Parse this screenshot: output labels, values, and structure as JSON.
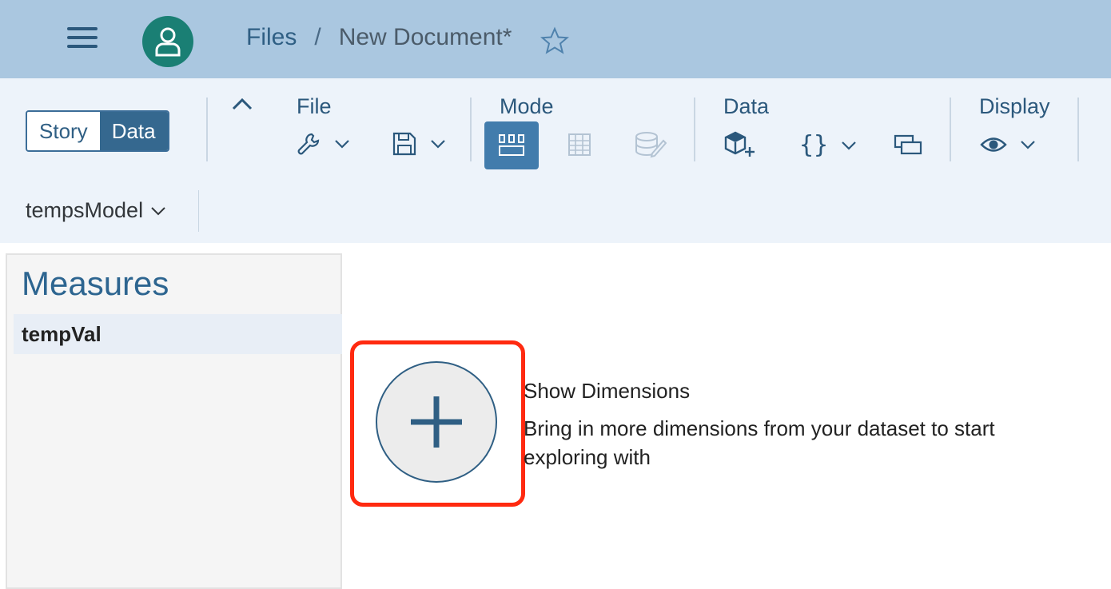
{
  "header": {
    "breadcrumb_root": "Files",
    "breadcrumb_sep": "/",
    "breadcrumb_current": "New Document*"
  },
  "toolbar": {
    "toggle_story": "Story",
    "toggle_data": "Data",
    "groups": {
      "file": "File",
      "mode": "Mode",
      "data": "Data",
      "display": "Display"
    },
    "model_name": "tempsModel"
  },
  "measures": {
    "title": "Measures",
    "items": [
      "tempVal"
    ]
  },
  "empty_state": {
    "title": "Show Dimensions",
    "description": "Bring in more dimensions from your dataset to start exploring with"
  },
  "colors": {
    "shell": "#aac7e0",
    "toolbar": "#edf3fa",
    "accent": "#427cac",
    "highlight": "#ff2a10"
  }
}
